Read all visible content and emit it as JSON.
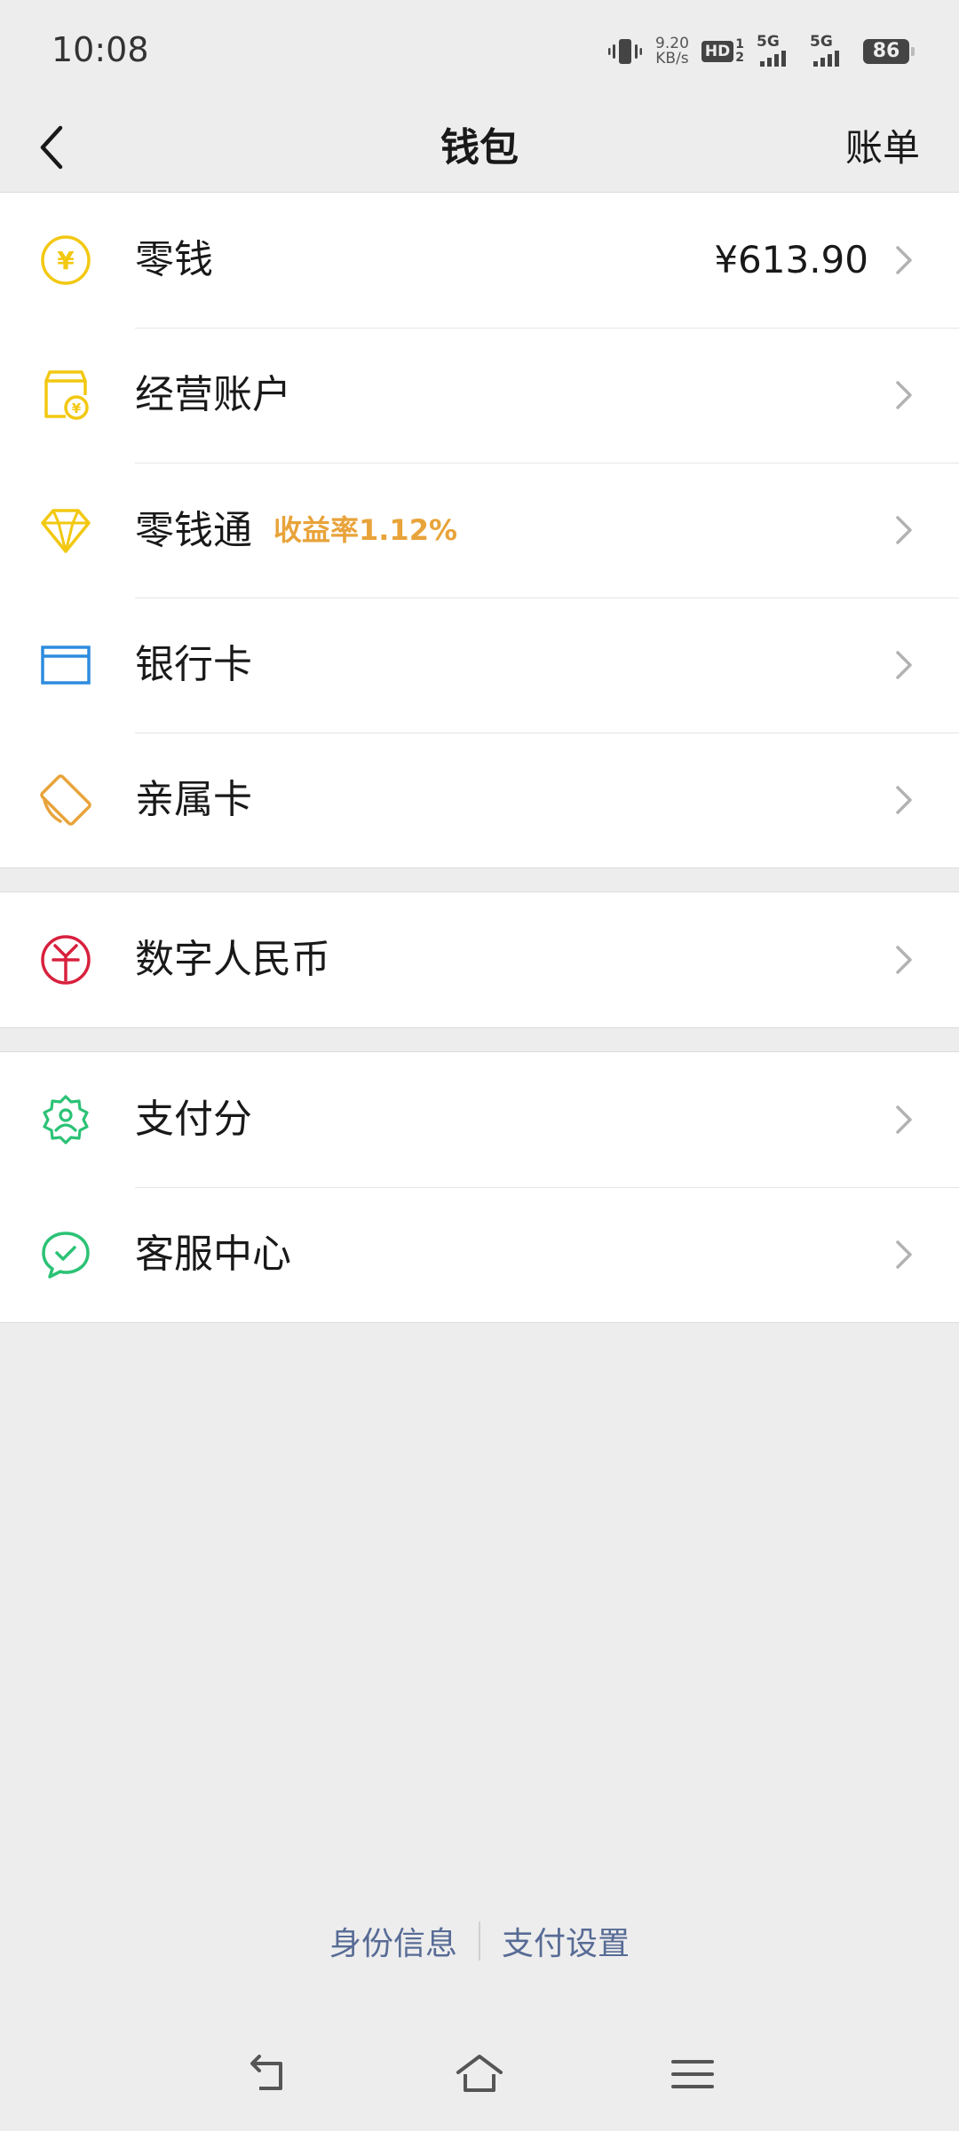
{
  "status_bar": {
    "time": "10:08",
    "net_speed_value": "9.20",
    "net_speed_unit": "KB/s",
    "hd_label": "HD",
    "hd_sub_top": "1",
    "hd_sub_bottom": "2",
    "signal1_label": "5G",
    "signal2_label": "5G",
    "battery_level": "86",
    "icons": [
      "vibrate-icon",
      "signal-icon",
      "battery-icon"
    ]
  },
  "nav": {
    "title": "钱包",
    "right_label": "账单",
    "back_icon": "chevron-left-icon"
  },
  "groups": [
    {
      "items": [
        {
          "label": "零钱",
          "value": "¥613.90",
          "icon": "yuan-coin-icon",
          "color": "#F2C811"
        },
        {
          "label": "经营账户",
          "icon": "shop-account-icon",
          "color": "#F2C811"
        },
        {
          "label": "零钱通",
          "tag": "收益率1.12%",
          "icon": "diamond-icon",
          "color": "#F2C811"
        },
        {
          "label": "银行卡",
          "icon": "bank-card-icon",
          "color": "#2D8CDE"
        },
        {
          "label": "亲属卡",
          "icon": "family-card-icon",
          "color": "#E8A33A"
        }
      ]
    },
    {
      "items": [
        {
          "label": "数字人民币",
          "icon": "digital-rmb-icon",
          "color": "#D8203D"
        }
      ]
    },
    {
      "items": [
        {
          "label": "支付分",
          "icon": "pay-score-icon",
          "color": "#2BC275"
        },
        {
          "label": "客服中心",
          "icon": "customer-service-icon",
          "color": "#2BC275"
        }
      ]
    }
  ],
  "footer": {
    "left_link": "身份信息",
    "right_link": "支付设置",
    "link_color": "#576B95"
  },
  "system_nav": {
    "icons": [
      "back-icon",
      "home-icon",
      "menu-icon"
    ]
  }
}
